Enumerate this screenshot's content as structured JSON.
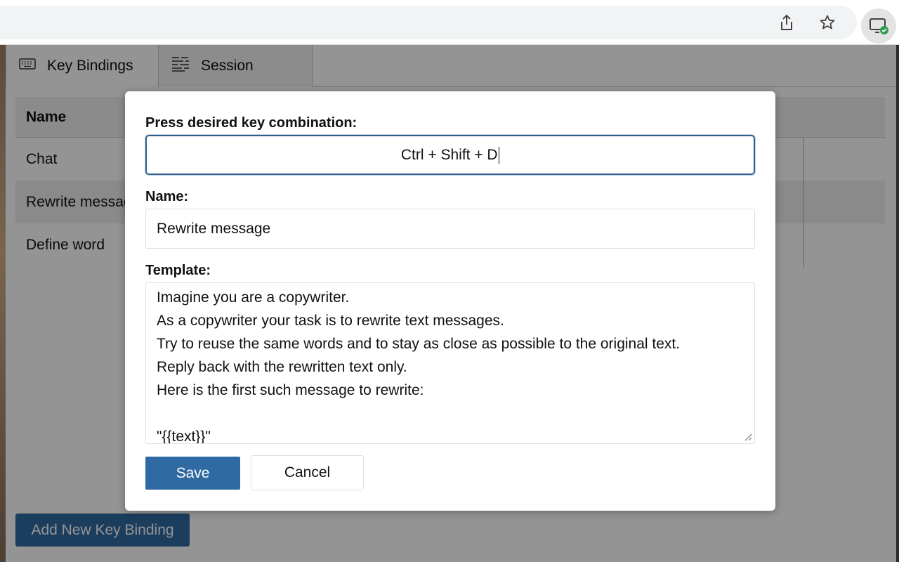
{
  "browser": {
    "share_icon": "share-icon",
    "star_icon": "star-icon",
    "extension_icon": "extension-icon"
  },
  "tabs": [
    {
      "label": "Key Bindings",
      "icon": "keyboard-icon"
    },
    {
      "label": "Session",
      "icon": "list-icon"
    }
  ],
  "table": {
    "header": "Name",
    "rows": [
      "Chat",
      "Rewrite message",
      "Define word"
    ]
  },
  "add_button_label": "Add New Key Binding",
  "modal": {
    "key_label": "Press desired key combination:",
    "key_value": "Ctrl + Shift + D",
    "name_label": "Name:",
    "name_value": "Rewrite message",
    "template_label": "Template:",
    "template_lines": [
      "Imagine you are a copywriter.",
      "As a copywriter your task is to rewrite text messages.",
      "Try to reuse the same words and to stay as close as possible to the original text.",
      "Reply back with the rewritten text only.",
      "Here is the first such message to rewrite:",
      "",
      "\"{{text}}\""
    ],
    "save_label": "Save",
    "cancel_label": "Cancel"
  },
  "colors": {
    "primary": "#2f6aa2",
    "focus_border": "#2f5f8f",
    "extension_badge": "#2e9b4f"
  }
}
